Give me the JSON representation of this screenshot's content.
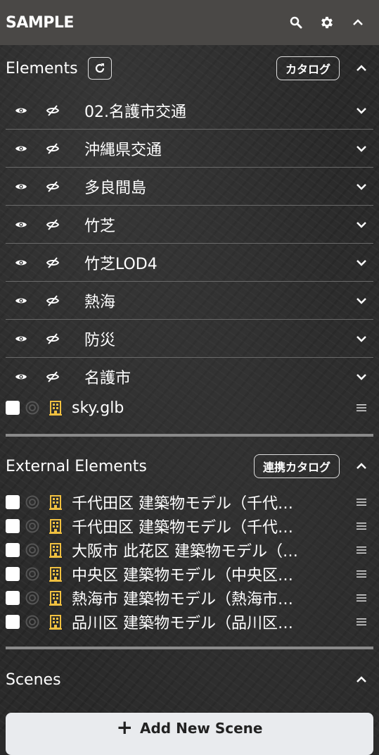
{
  "header": {
    "title": "SAMPLE"
  },
  "elements_section": {
    "label": "Elements",
    "catalog_label": "カタログ",
    "items": [
      {
        "name": "02.名護市交通"
      },
      {
        "name": "沖縄県交通"
      },
      {
        "name": "多良間島"
      },
      {
        "name": "竹芝"
      },
      {
        "name": "竹芝LOD4"
      },
      {
        "name": "熱海"
      },
      {
        "name": "防災"
      },
      {
        "name": "名護市"
      }
    ],
    "files": [
      {
        "name": "sky.glb",
        "checked": false
      }
    ]
  },
  "external_section": {
    "label": "External Elements",
    "catalog_label": "連携カタログ",
    "items": [
      {
        "name": "千代田区 建築物モデル（千代…",
        "checked": false
      },
      {
        "name": "千代田区 建築物モデル（千代…",
        "checked": false
      },
      {
        "name": "大阪市 此花区 建築物モデル（…",
        "checked": false
      },
      {
        "name": "中央区 建築物モデル（中央区…",
        "checked": false
      },
      {
        "name": "熱海市 建築物モデル（熱海市…",
        "checked": false
      },
      {
        "name": "品川区 建築物モデル（品川区…",
        "checked": false
      }
    ]
  },
  "scenes_section": {
    "label": "Scenes",
    "add_scene_label": "Add New Scene"
  },
  "colors": {
    "topbar": "#4a4846",
    "building_icon": "#f0c040",
    "divider": "#8a8a8a"
  }
}
